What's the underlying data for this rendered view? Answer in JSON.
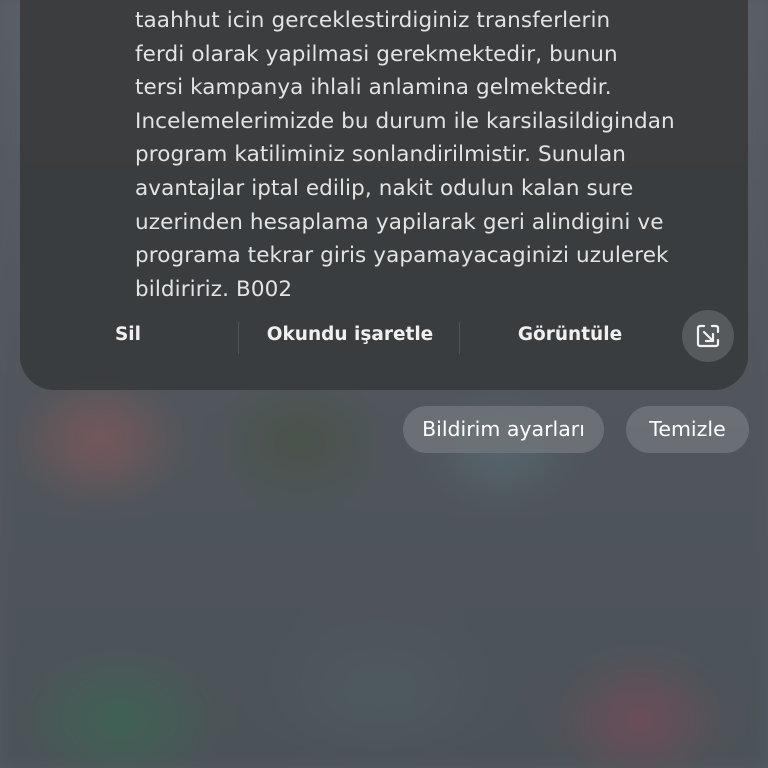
{
  "notification": {
    "message_lines": [
      "taahhut icin gerceklestirdiginiz transferlerin",
      "ferdi olarak yapilmasi gerekmektedir, bunun",
      "tersi kampanya ihlali anlamina gelmektedir.",
      "Incelemelerimizde bu durum ile karsilasildigindan",
      "program katiliminiz sonlandirilmistir. Sunulan",
      "avantajlar iptal edilip, nakit odulun kalan sure",
      "uzerinden hesaplama yapilarak geri alindigini ve",
      "programa tekrar giris yapamayacaginizi uzulerek",
      "bildiririz. B002"
    ],
    "actions": {
      "delete_label": "Sil",
      "mark_read_label": "Okundu işaretle",
      "view_label": "Görüntüle",
      "open_icon": "open-in-app-icon"
    }
  },
  "footer_buttons": {
    "settings_label": "Bildirim ayarları",
    "clear_label": "Temizle"
  },
  "colors": {
    "card_background": "#3a3c3e",
    "text_primary": "#e3e3e3",
    "pill_background": "#6e747a"
  }
}
